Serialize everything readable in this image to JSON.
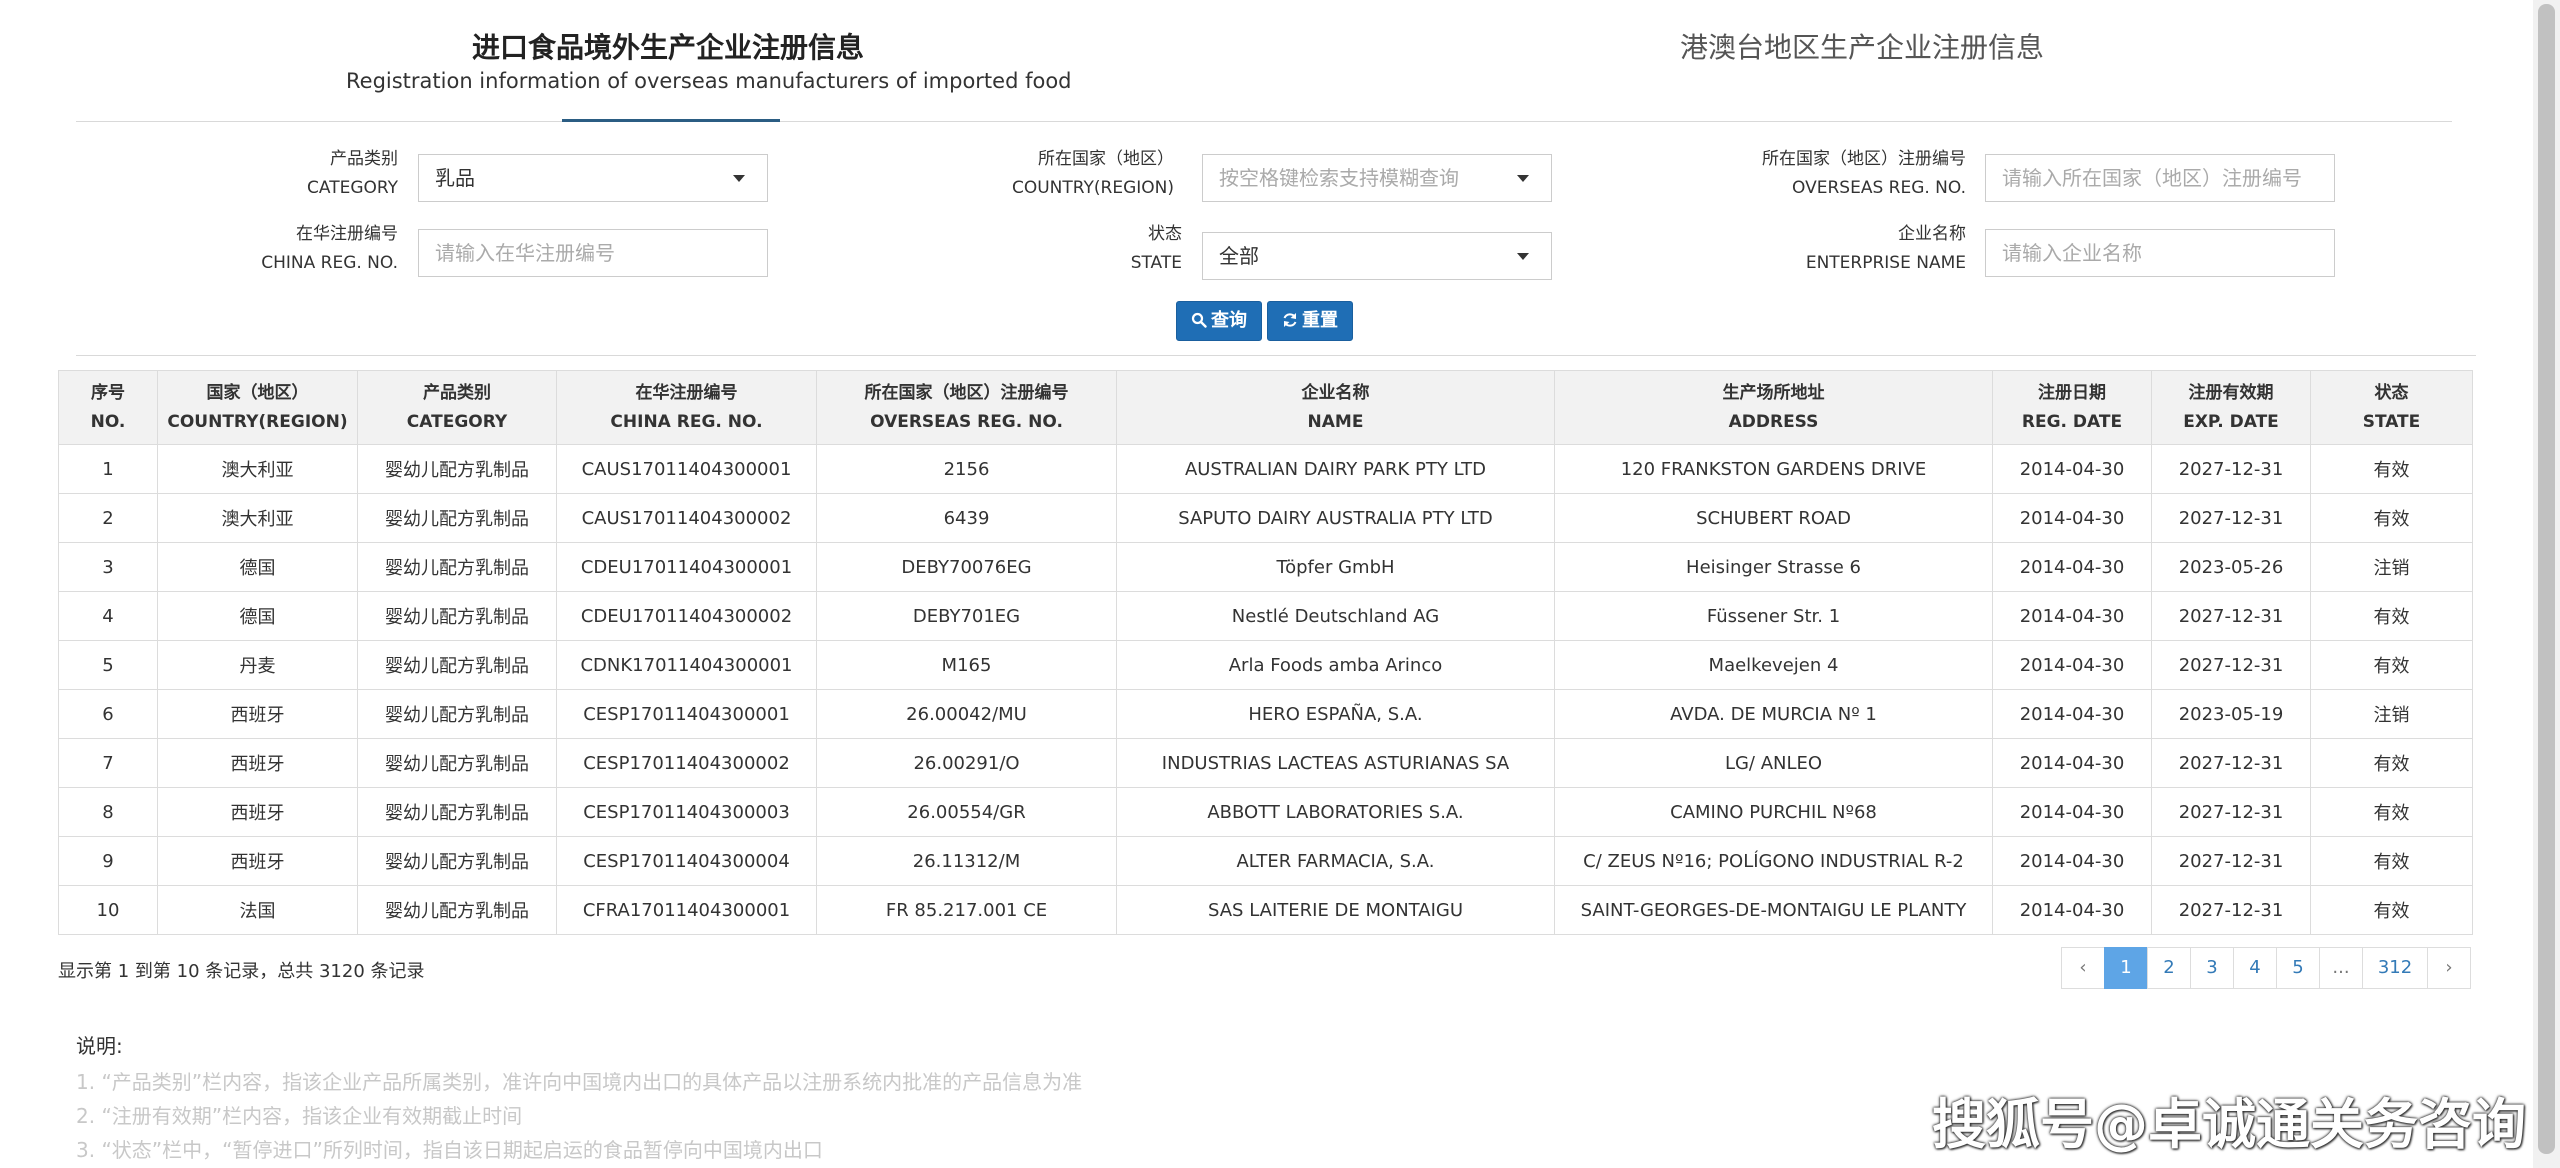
{
  "tabs": [
    {
      "title_cn": "进口食品境外生产企业注册信息",
      "title_en": "Registration information of overseas manufacturers of imported food"
    },
    {
      "title_cn": "港澳台地区生产企业注册信息"
    }
  ],
  "filters": {
    "category": {
      "label_cn": "产品类别",
      "label_en": "CATEGORY",
      "value": "乳品"
    },
    "country": {
      "label_cn": "所在国家（地区）",
      "label_en": "COUNTRY(REGION)",
      "placeholder": "按空格键检索支持模糊查询"
    },
    "overseas_reg": {
      "label_cn": "所在国家（地区）注册编号",
      "label_en": "OVERSEAS REG. NO.",
      "placeholder": "请输入所在国家（地区）注册编号"
    },
    "china_reg": {
      "label_cn": "在华注册编号",
      "label_en": "CHINA REG. NO.",
      "placeholder": "请输入在华注册编号"
    },
    "state": {
      "label_cn": "状态",
      "label_en": "STATE",
      "value": "全部"
    },
    "enterprise": {
      "label_cn": "企业名称",
      "label_en": "ENTERPRISE NAME",
      "placeholder": "请输入企业名称"
    }
  },
  "buttons": {
    "search": "查询",
    "reset": "重置"
  },
  "table": {
    "headers": [
      {
        "cn": "序号",
        "en": "NO."
      },
      {
        "cn": "国家（地区）",
        "en": "COUNTRY(REGION)"
      },
      {
        "cn": "产品类别",
        "en": "CATEGORY"
      },
      {
        "cn": "在华注册编号",
        "en": "CHINA REG. NO."
      },
      {
        "cn": "所在国家（地区）注册编号",
        "en": "OVERSEAS REG. NO."
      },
      {
        "cn": "企业名称",
        "en": "NAME"
      },
      {
        "cn": "生产场所地址",
        "en": "ADDRESS"
      },
      {
        "cn": "注册日期",
        "en": "REG. DATE"
      },
      {
        "cn": "注册有效期",
        "en": "EXP. DATE"
      },
      {
        "cn": "状态",
        "en": "STATE"
      }
    ],
    "rows": [
      [
        "1",
        "澳大利亚",
        "婴幼儿配方乳制品",
        "CAUS17011404300001",
        "2156",
        "AUSTRALIAN DAIRY PARK PTY LTD",
        "120 FRANKSTON GARDENS DRIVE",
        "2014-04-30",
        "2027-12-31",
        "有效"
      ],
      [
        "2",
        "澳大利亚",
        "婴幼儿配方乳制品",
        "CAUS17011404300002",
        "6439",
        "SAPUTO DAIRY AUSTRALIA PTY LTD",
        "SCHUBERT ROAD",
        "2014-04-30",
        "2027-12-31",
        "有效"
      ],
      [
        "3",
        "德国",
        "婴幼儿配方乳制品",
        "CDEU17011404300001",
        "DEBY70076EG",
        "Töpfer GmbH",
        "Heisinger Strasse 6",
        "2014-04-30",
        "2023-05-26",
        "注销"
      ],
      [
        "4",
        "德国",
        "婴幼儿配方乳制品",
        "CDEU17011404300002",
        "DEBY701EG",
        "Nestlé Deutschland AG",
        "Füssener Str. 1",
        "2014-04-30",
        "2027-12-31",
        "有效"
      ],
      [
        "5",
        "丹麦",
        "婴幼儿配方乳制品",
        "CDNK17011404300001",
        "M165",
        "Arla Foods amba Arinco",
        "Maelkevejen 4",
        "2014-04-30",
        "2027-12-31",
        "有效"
      ],
      [
        "6",
        "西班牙",
        "婴幼儿配方乳制品",
        "CESP17011404300001",
        "26.00042/MU",
        "HERO ESPAÑA, S.A.",
        "AVDA. DE MURCIA Nº 1",
        "2014-04-30",
        "2023-05-19",
        "注销"
      ],
      [
        "7",
        "西班牙",
        "婴幼儿配方乳制品",
        "CESP17011404300002",
        "26.00291/O",
        "INDUSTRIAS LACTEAS ASTURIANAS SA",
        "LG/ ANLEO",
        "2014-04-30",
        "2027-12-31",
        "有效"
      ],
      [
        "8",
        "西班牙",
        "婴幼儿配方乳制品",
        "CESP17011404300003",
        "26.00554/GR",
        "ABBOTT LABORATORIES S.A.",
        "CAMINO PURCHIL Nº68",
        "2014-04-30",
        "2027-12-31",
        "有效"
      ],
      [
        "9",
        "西班牙",
        "婴幼儿配方乳制品",
        "CESP17011404300004",
        "26.11312/M",
        "ALTER FARMACIA, S.A.",
        "C/ ZEUS Nº16; POLÍGONO INDUSTRIAL R-2",
        "2014-04-30",
        "2027-12-31",
        "有效"
      ],
      [
        "10",
        "法国",
        "婴幼儿配方乳制品",
        "CFRA17011404300001",
        "FR 85.217.001 CE",
        "SAS LAITERIE DE MONTAIGU",
        "SAINT-GEORGES-DE-MONTAIGU LE PLANTY",
        "2014-04-30",
        "2027-12-31",
        "有效"
      ]
    ]
  },
  "summary": "显示第 1 到第 10 条记录，总共 3120 条记录",
  "pagination": {
    "prev": "‹",
    "pages": [
      "1",
      "2",
      "3",
      "4",
      "5"
    ],
    "ellipsis": "...",
    "last": "312",
    "next": "›",
    "active": "1"
  },
  "notes": {
    "title": "说明:",
    "items": [
      "1. “产品类别”栏内容，指该企业产品所属类别，准许向中国境内出口的具体产品以注册系统内批准的产品信息为准",
      "2. “注册有效期”栏内容，指该企业有效期截止时间",
      "3. “状态”栏中，“暂停进口”所列时间，指自该日期起启运的食品暂停向中国境内出口"
    ]
  },
  "watermark": "搜狐号@卓诚通关务咨询"
}
